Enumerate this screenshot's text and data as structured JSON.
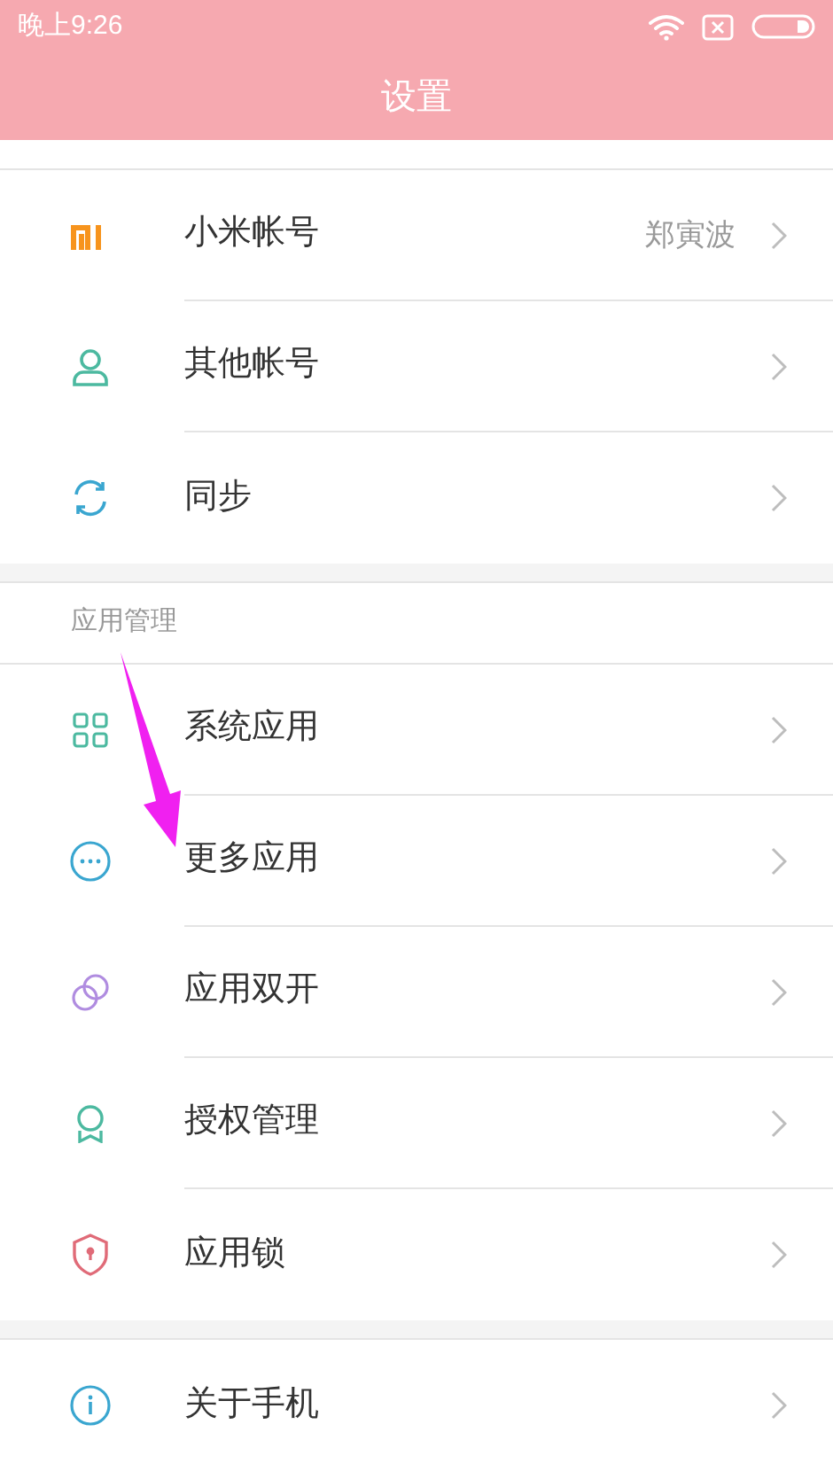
{
  "status_bar": {
    "time": "晚上9:26"
  },
  "title_bar": {
    "title": "设置"
  },
  "sections": [
    {
      "items": [
        {
          "label": "小米帐号",
          "value": "郑寅波"
        },
        {
          "label": "其他帐号"
        },
        {
          "label": "同步"
        }
      ]
    },
    {
      "header": "应用管理",
      "items": [
        {
          "label": "系统应用"
        },
        {
          "label": "更多应用"
        },
        {
          "label": "应用双开"
        },
        {
          "label": "授权管理"
        },
        {
          "label": "应用锁"
        }
      ]
    },
    {
      "items": [
        {
          "label": "关于手机"
        }
      ]
    }
  ]
}
